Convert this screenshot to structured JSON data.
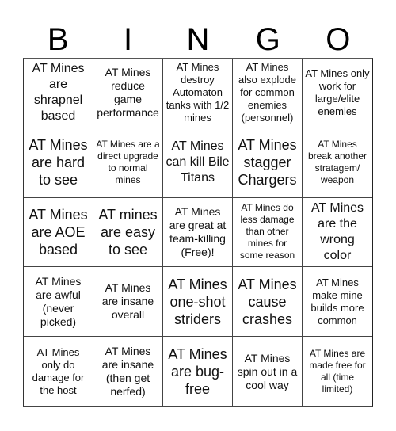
{
  "header": {
    "letters": [
      "B",
      "I",
      "N",
      "G",
      "O"
    ]
  },
  "cells": [
    {
      "text": "AT Mines are shrapnel based",
      "size": "lg"
    },
    {
      "text": "AT Mines reduce game performance",
      "size": "md"
    },
    {
      "text": "AT Mines destroy Automaton tanks with 1/2 mines",
      "size": "sm"
    },
    {
      "text": "AT Mines also explode for common enemies (personnel)",
      "size": "sm"
    },
    {
      "text": "AT Mines only work for large/elite enemies",
      "size": "sm"
    },
    {
      "text": "AT Mines are hard to see",
      "size": "xl"
    },
    {
      "text": "AT Mines are a direct upgrade to normal mines",
      "size": "xs"
    },
    {
      "text": "AT Mines can kill Bile Titans",
      "size": "lg"
    },
    {
      "text": "AT Mines stagger Chargers",
      "size": "xl"
    },
    {
      "text": "AT Mines break another stratagem/ weapon",
      "size": "xs"
    },
    {
      "text": "AT Mines are AOE based",
      "size": "xl"
    },
    {
      "text": "AT mines are easy to see",
      "size": "xl"
    },
    {
      "text": "AT Mines are great at team-killing (Free)!",
      "size": "md"
    },
    {
      "text": "AT Mines do less damage than other mines for some reason",
      "size": "xs"
    },
    {
      "text": "AT Mines are the wrong color",
      "size": "lg"
    },
    {
      "text": "AT Mines are awful (never picked)",
      "size": "md"
    },
    {
      "text": "AT Mines are insane overall",
      "size": "md"
    },
    {
      "text": "AT Mines one-shot striders",
      "size": "xl"
    },
    {
      "text": "AT Mines cause crashes",
      "size": "xl"
    },
    {
      "text": "AT Mines make mine builds more common",
      "size": "sm"
    },
    {
      "text": "AT Mines only do damage for the host",
      "size": "sm"
    },
    {
      "text": "AT Mines are insane (then get nerfed)",
      "size": "md"
    },
    {
      "text": "AT Mines are bug-free",
      "size": "xl"
    },
    {
      "text": "AT Mines spin out in a cool way",
      "size": "md"
    },
    {
      "text": "AT Mines are made free for all (time limited)",
      "size": "xs"
    }
  ]
}
